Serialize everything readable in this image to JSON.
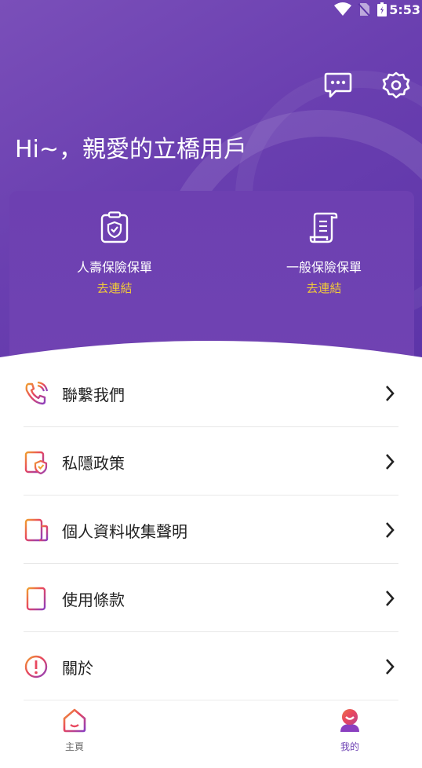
{
  "status_bar": {
    "time": "5:53"
  },
  "header": {
    "greeting": "Hi~，親愛的立橋用戶",
    "icons": [
      "chat-icon",
      "settings-icon"
    ]
  },
  "policy_card": {
    "items": [
      {
        "title": "人壽保險保單",
        "action": "去連結",
        "icon": "shield-clipboard-icon"
      },
      {
        "title": "一般保險保單",
        "action": "去連結",
        "icon": "scroll-document-icon"
      }
    ],
    "action_color": "#f0c93a"
  },
  "menu": {
    "items": [
      {
        "label": "聯繫我們",
        "icon": "phone-icon"
      },
      {
        "label": "私隱政策",
        "icon": "privacy-shield-icon"
      },
      {
        "label": "個人資料收集聲明",
        "icon": "data-document-icon"
      },
      {
        "label": "使用條款",
        "icon": "terms-list-icon"
      },
      {
        "label": "關於",
        "icon": "info-alert-icon"
      }
    ]
  },
  "tab_bar": {
    "tabs": [
      {
        "label": "主頁",
        "icon": "home-icon",
        "active": false
      },
      {
        "label": "我的",
        "icon": "profile-icon",
        "active": true
      }
    ],
    "active_color": "#6b3fb2",
    "inactive_color": "#666666"
  },
  "colors": {
    "brand_purple": "#6a3fb0",
    "accent_gradient_start": "#e8475f",
    "accent_gradient_end": "#8a3fc0"
  }
}
